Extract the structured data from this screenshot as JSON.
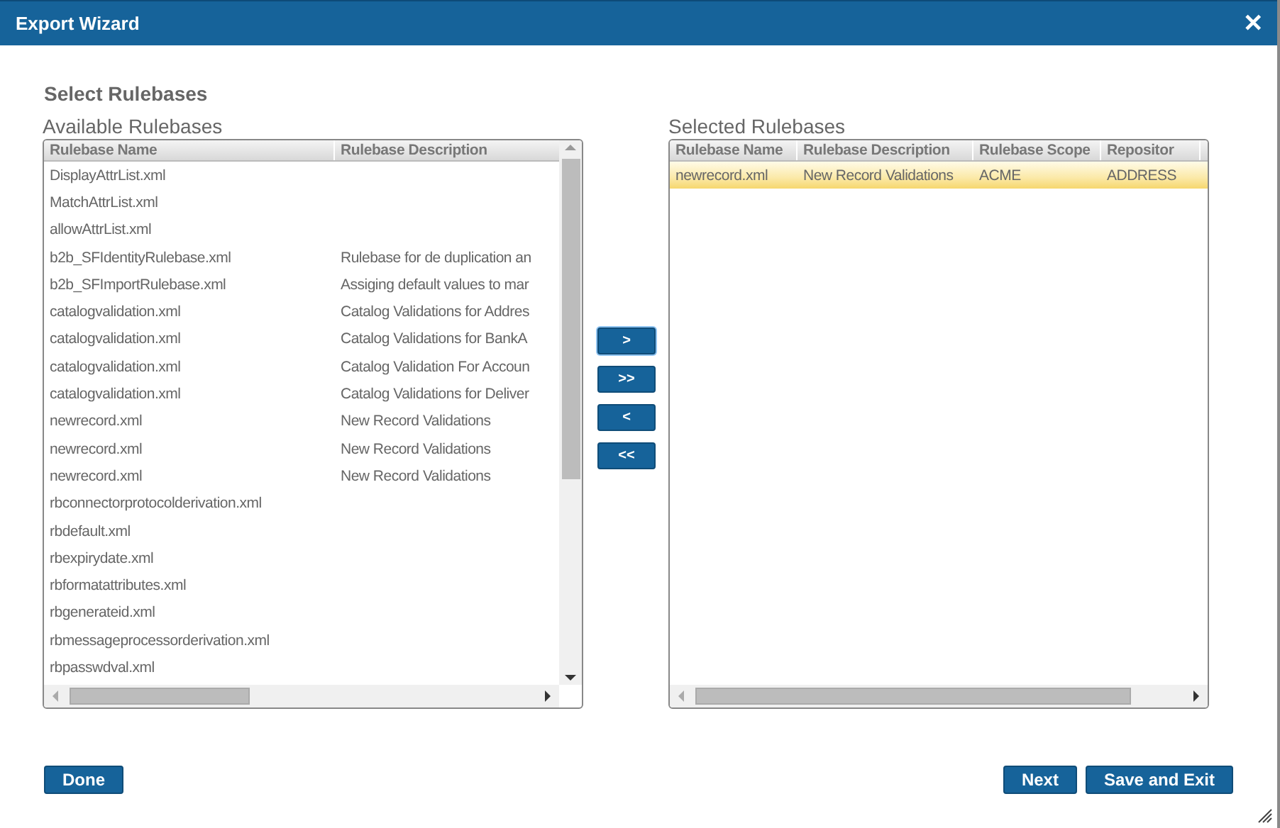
{
  "window": {
    "title": "Export Wizard",
    "close_label": "✕"
  },
  "heading": "Select Rulebases",
  "available": {
    "label": "Available Rulebases",
    "columns": [
      "Rulebase Name",
      "Rulebase Description"
    ],
    "rows": [
      {
        "cells": [
          "DisplayAttrList.xml",
          ""
        ],
        "selected": false
      },
      {
        "cells": [
          "MatchAttrList.xml",
          ""
        ],
        "selected": false
      },
      {
        "cells": [
          "allowAttrList.xml",
          ""
        ],
        "selected": false
      },
      {
        "cells": [
          "b2b_SFIdentityRulebase.xml",
          "Rulebase for de duplication an"
        ],
        "selected": false
      },
      {
        "cells": [
          "b2b_SFImportRulebase.xml",
          "Assiging default values to mar"
        ],
        "selected": false
      },
      {
        "cells": [
          "catalogvalidation.xml",
          "Catalog Validations for Addres"
        ],
        "selected": false
      },
      {
        "cells": [
          "catalogvalidation.xml",
          "Catalog Validations for BankA"
        ],
        "selected": false
      },
      {
        "cells": [
          "catalogvalidation.xml",
          "Catalog Validation For Accoun"
        ],
        "selected": false
      },
      {
        "cells": [
          "catalogvalidation.xml",
          "Catalog Validations for Deliver"
        ],
        "selected": false
      },
      {
        "cells": [
          "newrecord.xml",
          "New Record Validations"
        ],
        "selected": false
      },
      {
        "cells": [
          "newrecord.xml",
          "New Record Validations"
        ],
        "selected": false
      },
      {
        "cells": [
          "newrecord.xml",
          "New Record Validations"
        ],
        "selected": false
      },
      {
        "cells": [
          "rbconnectorprotocolderivation.xml",
          ""
        ],
        "selected": false
      },
      {
        "cells": [
          "rbdefault.xml",
          ""
        ],
        "selected": false
      },
      {
        "cells": [
          "rbexpirydate.xml",
          ""
        ],
        "selected": false
      },
      {
        "cells": [
          "rbformatattributes.xml",
          ""
        ],
        "selected": false
      },
      {
        "cells": [
          "rbgenerateid.xml",
          ""
        ],
        "selected": false
      },
      {
        "cells": [
          "rbmessageprocessorderivation.xml",
          ""
        ],
        "selected": false
      },
      {
        "cells": [
          "rbpasswdval.xml",
          ""
        ],
        "selected": false
      }
    ]
  },
  "move_buttons": [
    {
      "label": ">",
      "focused": true
    },
    {
      "label": ">>",
      "focused": false
    },
    {
      "label": "<",
      "focused": false
    },
    {
      "label": "<<",
      "focused": false
    }
  ],
  "selected": {
    "label": "Selected Rulebases",
    "columns": [
      "Rulebase Name",
      "Rulebase Description",
      "Rulebase Scope",
      "Repositor"
    ],
    "rows": [
      {
        "cells": [
          "newrecord.xml",
          "New Record Validations",
          "ACME",
          "ADDRESS"
        ],
        "selected": true
      }
    ]
  },
  "footer": {
    "left_buttons": [
      "Done"
    ],
    "right_buttons": [
      "Next",
      "Save and Exit"
    ]
  }
}
